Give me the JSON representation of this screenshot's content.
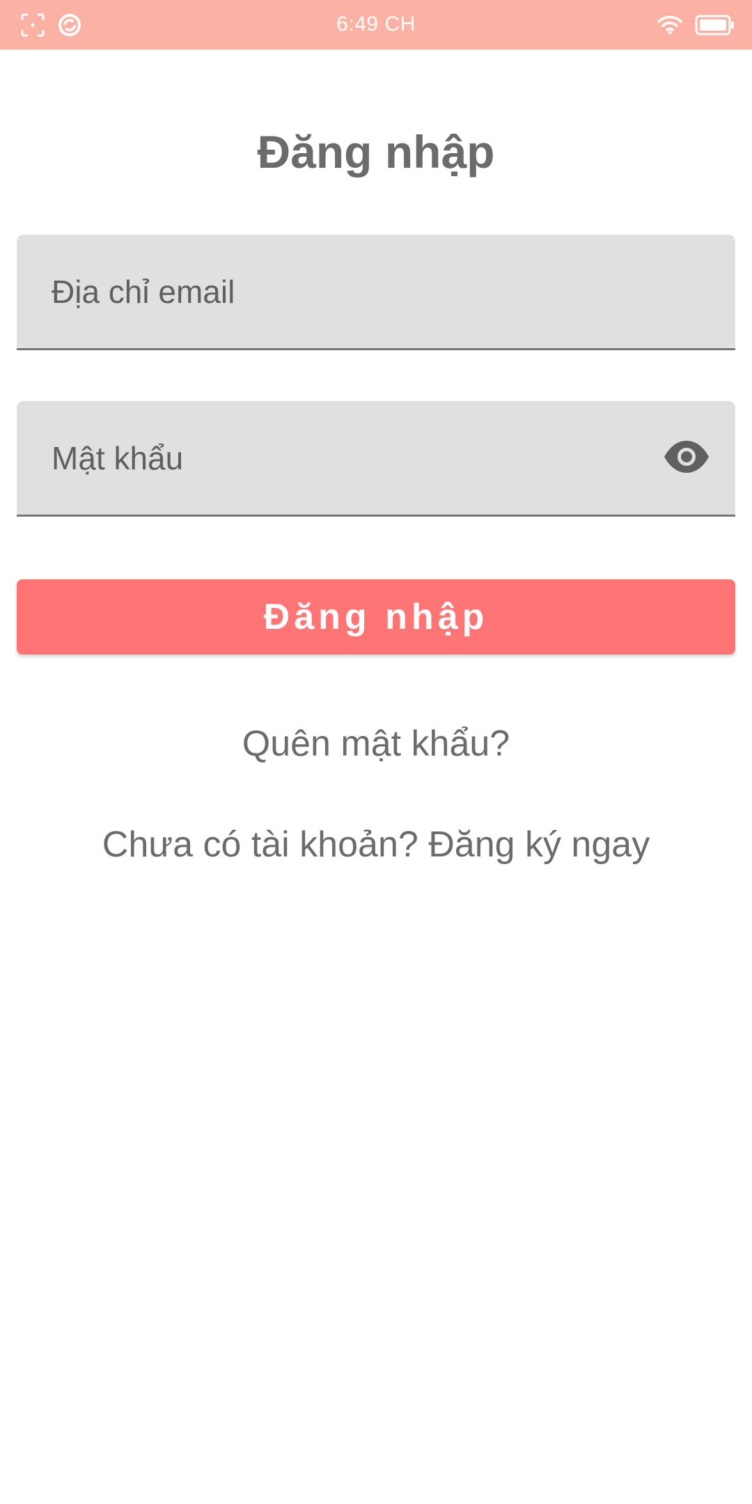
{
  "status_bar": {
    "time": "6:49 CH",
    "background_color": "#fbb2a4",
    "left_icons": [
      "screenshot-icon",
      "sync-icon"
    ],
    "right_icons": [
      "wifi-icon",
      "battery-icon"
    ]
  },
  "login": {
    "title": "Đăng nhập",
    "email_placeholder": "Địa chỉ email",
    "password_placeholder": "Mật khẩu",
    "show_password_icon": "eye-icon",
    "submit_label": "Đăng nhập",
    "forgot_password": "Quên mật khẩu?",
    "register_prompt": "Chưa có tài khoản? Đăng ký ngay"
  },
  "colors": {
    "accent": "#ff7575",
    "field_background": "#e0e0e0",
    "text": "#6b6b6b"
  }
}
